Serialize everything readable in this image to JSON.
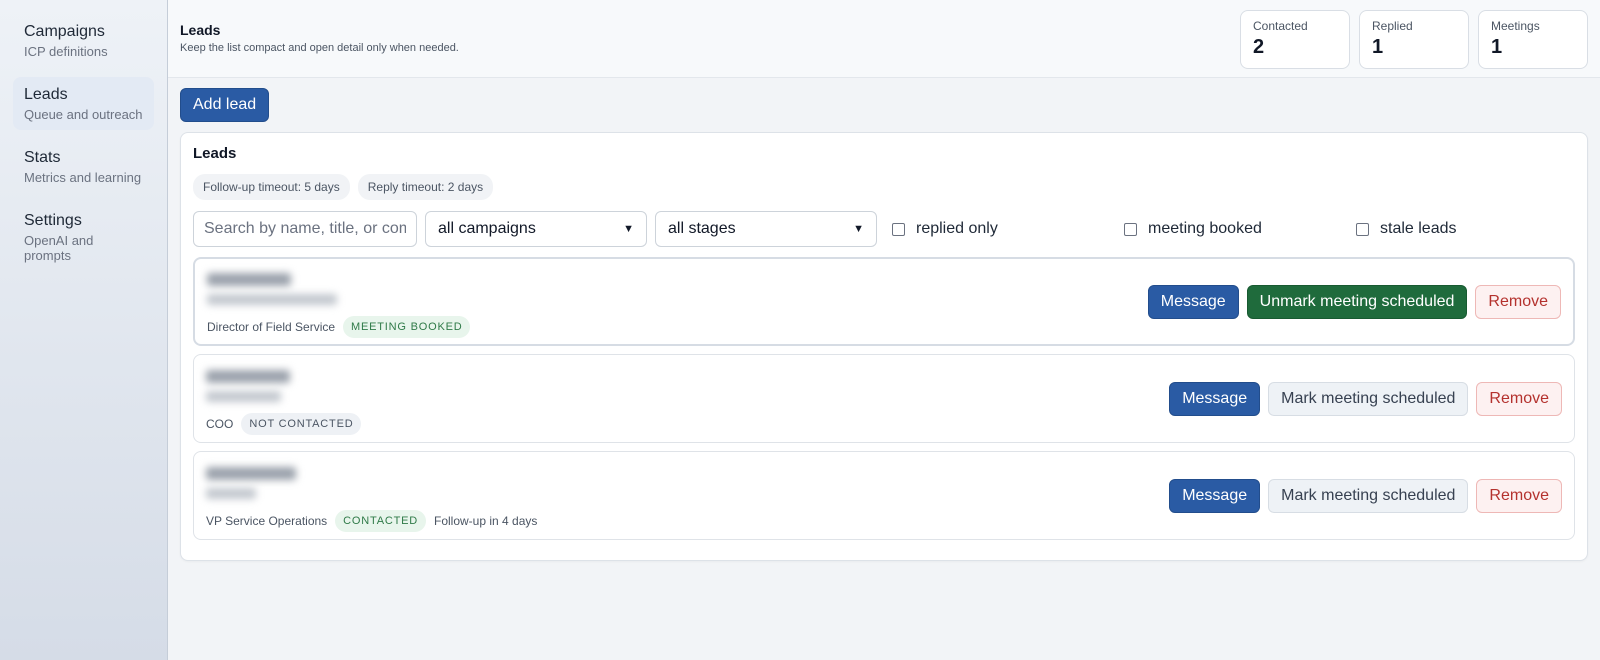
{
  "sidebar": {
    "items": [
      {
        "title": "Campaigns",
        "sub": "ICP definitions"
      },
      {
        "title": "Leads",
        "sub": "Queue and outreach"
      },
      {
        "title": "Stats",
        "sub": "Metrics and learning"
      },
      {
        "title": "Settings",
        "sub": "OpenAI and prompts"
      }
    ]
  },
  "header": {
    "title": "Leads",
    "subtitle": "Keep the list compact and open detail only when needed.",
    "stats": [
      {
        "label": "Contacted",
        "value": "2"
      },
      {
        "label": "Replied",
        "value": "1"
      },
      {
        "label": "Meetings",
        "value": "1"
      }
    ]
  },
  "toolbar": {
    "add_label": "Add lead"
  },
  "panel": {
    "title": "Leads",
    "chips": [
      "Follow-up timeout: 5 days",
      "Reply timeout: 2 days"
    ],
    "search_placeholder": "Search by name, title, or company",
    "campaign_select": "all campaigns",
    "stage_select": "all stages",
    "checks": [
      "replied only",
      "meeting booked",
      "stale leads"
    ]
  },
  "leads": [
    {
      "title": "Director of Field Service",
      "stage": "MEETING BOOKED",
      "note": "",
      "message": "Message",
      "meeting": "Unmark meeting scheduled",
      "remove": "Remove"
    },
    {
      "title": "COO",
      "stage": "NOT CONTACTED",
      "note": "",
      "message": "Message",
      "meeting": "Mark meeting scheduled",
      "remove": "Remove"
    },
    {
      "title": "VP Service Operations",
      "stage": "CONTACTED",
      "note": "Follow-up in 4 days",
      "message": "Message",
      "meeting": "Mark meeting scheduled",
      "remove": "Remove"
    }
  ]
}
